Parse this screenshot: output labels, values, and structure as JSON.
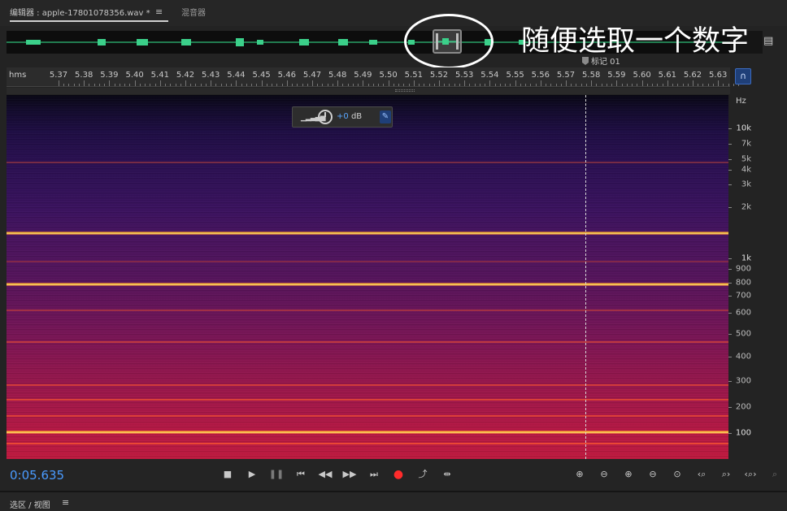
{
  "tabs": {
    "editor_label": "编辑器 : apple-17801078356.wav *",
    "menu_icon": "≡",
    "mixer_label": "混音器"
  },
  "overview": {
    "menu_icon": "▤"
  },
  "annotation": {
    "text": "随便选取一个数字"
  },
  "marker": {
    "label": "标记 01"
  },
  "ruler": {
    "unit": "hms",
    "ticks": [
      "5.37",
      "5.38",
      "5.39",
      "5.40",
      "5.41",
      "5.42",
      "5.43",
      "5.44",
      "5.45",
      "5.46",
      "5.47",
      "5.48",
      "5.49",
      "5.50",
      "5.51",
      "5.52",
      "5.53",
      "5.54",
      "5.55",
      "5.56",
      "5.57",
      "5.58",
      "5.59",
      "5.60",
      "5.61",
      "5.62",
      "5.63"
    ]
  },
  "float_panel": {
    "gain_value": "+0",
    "gain_unit": "dB"
  },
  "freq_scale": {
    "unit": "Hz",
    "labels": [
      "10k",
      "7k",
      "5k",
      "4k",
      "3k",
      "2k",
      "1k",
      "900",
      "800",
      "700",
      "600",
      "500",
      "400",
      "300",
      "200",
      "100"
    ]
  },
  "transport": {
    "timecode": "0:05.635",
    "stop_icon": "■",
    "play_icon": "▶",
    "pause_icon": "❚❚",
    "to_start_icon": "⏮",
    "rewind_icon": "◀◀",
    "forward_icon": "▶▶",
    "to_end_icon": "⏭",
    "record_icon": "●",
    "loop_icon": "⤴",
    "skip_icon": "⇹",
    "zoom_in_amplitude_icon": "⊕",
    "zoom_out_amplitude_icon": "⊖",
    "zoom_in_time_icon": "⊕",
    "zoom_out_time_icon": "⊖",
    "zoom_full_icon": "⊙",
    "zoom_in_left_icon": "‹⌕",
    "zoom_in_right_icon": "⌕›",
    "zoom_selection_icon": "‹⌕›"
  },
  "bottom_panel": {
    "title": "选区 / 视图",
    "menu_icon": "≡"
  }
}
